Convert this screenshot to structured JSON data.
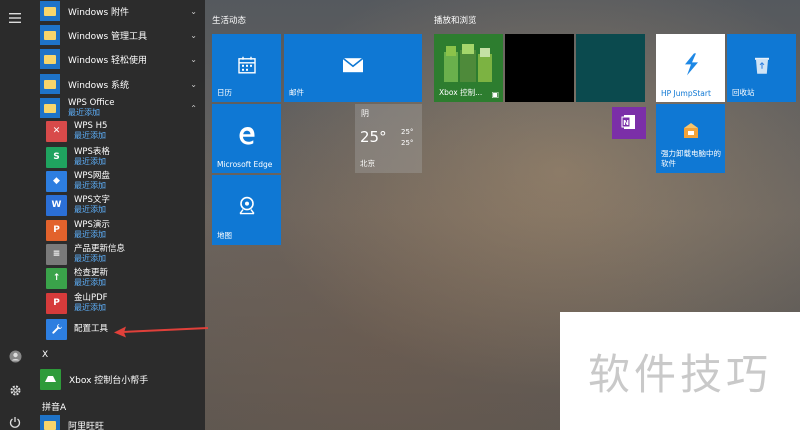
{
  "rail": {
    "menu_icon": "hamburger-icon",
    "user_icon": "user-icon",
    "settings_icon": "gear-icon",
    "power_icon": "power-icon"
  },
  "applist": {
    "folders": [
      {
        "label": "Windows 附件",
        "chevron": "chevron-down"
      },
      {
        "label": "Windows 管理工具",
        "chevron": "chevron-down"
      },
      {
        "label": "Windows 轻松使用",
        "chevron": "chevron-down"
      },
      {
        "label": "Windows 系统",
        "chevron": "chevron-down"
      }
    ],
    "wps_folder": {
      "label": "WPS Office",
      "sub": "最近添加",
      "chevron": "chevron-up"
    },
    "apps": [
      {
        "name": "WPS H5",
        "sub": "最近添加",
        "icon": "wps-h5-icon",
        "color": "#d84a4a",
        "glyph": "✕"
      },
      {
        "name": "WPS表格",
        "sub": "最近添加",
        "icon": "wps-sheets-icon",
        "color": "#1fa35f",
        "glyph": "S"
      },
      {
        "name": "WPS网盘",
        "sub": "最近添加",
        "icon": "wps-cloud-icon",
        "color": "#2d7ee0",
        "glyph": "◆"
      },
      {
        "name": "WPS文字",
        "sub": "最近添加",
        "icon": "wps-writer-icon",
        "color": "#2b6fd6",
        "glyph": "W"
      },
      {
        "name": "WPS演示",
        "sub": "最近添加",
        "icon": "wps-presentation-icon",
        "color": "#e2622c",
        "glyph": "P"
      },
      {
        "name": "产品更新信息",
        "sub": "最近添加",
        "icon": "product-update-icon",
        "color": "#7a7a7a",
        "glyph": "≡"
      },
      {
        "name": "检查更新",
        "sub": "最近添加",
        "icon": "check-update-icon",
        "color": "#3aa34a",
        "glyph": "↑"
      },
      {
        "name": "金山PDF",
        "sub": "最近添加",
        "icon": "pdf-icon",
        "color": "#d63b3b",
        "glyph": "P"
      },
      {
        "name": "配置工具",
        "sub": "",
        "icon": "wrench-icon",
        "color": "#2d7ee0",
        "glyph": "🔧"
      }
    ],
    "section_x": "X",
    "xbox_app": {
      "name": "Xbox 控制台小帮手",
      "icon": "xbox-icon",
      "color": "#2e9b3a"
    },
    "section_pinyin": "拼音A",
    "last_app": {
      "name": "阿里旺旺",
      "icon": "folder-icon"
    }
  },
  "groups": {
    "life": "生活动态",
    "play": "播放和浏览"
  },
  "tiles": {
    "calendar": "日历",
    "mail": "邮件",
    "weather": {
      "condition": "阴",
      "temp": "25°",
      "hi": "25°",
      "lo": "25°",
      "city": "北京"
    },
    "edge": "Microsoft Edge",
    "maps": "地图",
    "xbox": "Xbox 控制...",
    "hp": "HP JumpStart",
    "recycle": "回收站",
    "uninstall": "强力卸载电脑中的软件"
  },
  "watermark": "软件技巧",
  "colors": {
    "tile_blue": "#0f78d4",
    "accent_link": "#5fb3ff",
    "onenote": "#7b2fa8",
    "arrow": "#e0403a"
  }
}
